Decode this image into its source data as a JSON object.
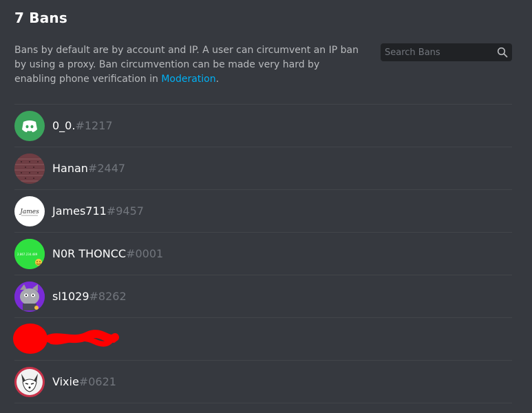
{
  "header": {
    "title": "7 Bans"
  },
  "description": {
    "text": "Bans by default are by account and IP. A user can circumvent an IP ban by using a proxy. Ban circumvention can be made very hard by enabling phone verification in ",
    "link_label": "Moderation",
    "suffix": "."
  },
  "search": {
    "placeholder": "Search Bans",
    "value": "",
    "icon": "search-icon"
  },
  "bans": [
    {
      "username": "0_0.",
      "discriminator": "#1217",
      "avatar": "discord-logo-icon",
      "avatar_color": "#3ba55c"
    },
    {
      "username": "Hanan",
      "discriminator": "#2447",
      "avatar": "brick-pattern",
      "avatar_color": "#6b3a3f"
    },
    {
      "username": "James711",
      "discriminator": "#9457",
      "avatar": "text-logo",
      "avatar_color": "#ffffff",
      "avatar_text": "James"
    },
    {
      "username": "N0R THONCC",
      "discriminator": "#0001",
      "avatar": "green-image",
      "avatar_color": "#2fe040",
      "avatar_text": "2.867.234.489"
    },
    {
      "username": "sl1029",
      "discriminator": "#8262",
      "avatar": "purple-character",
      "avatar_color": "#7a2bd6"
    },
    {
      "username": "",
      "discriminator": "",
      "avatar": "redacted",
      "avatar_color": "#ff0000",
      "redacted": true
    },
    {
      "username": "Vixie",
      "discriminator": "#0621",
      "avatar": "fox-character",
      "avatar_color": "#c8334a"
    }
  ],
  "colors": {
    "background": "#36393f",
    "link": "#00b0f4",
    "redaction": "#ff0000",
    "discriminator": "#72767d"
  }
}
